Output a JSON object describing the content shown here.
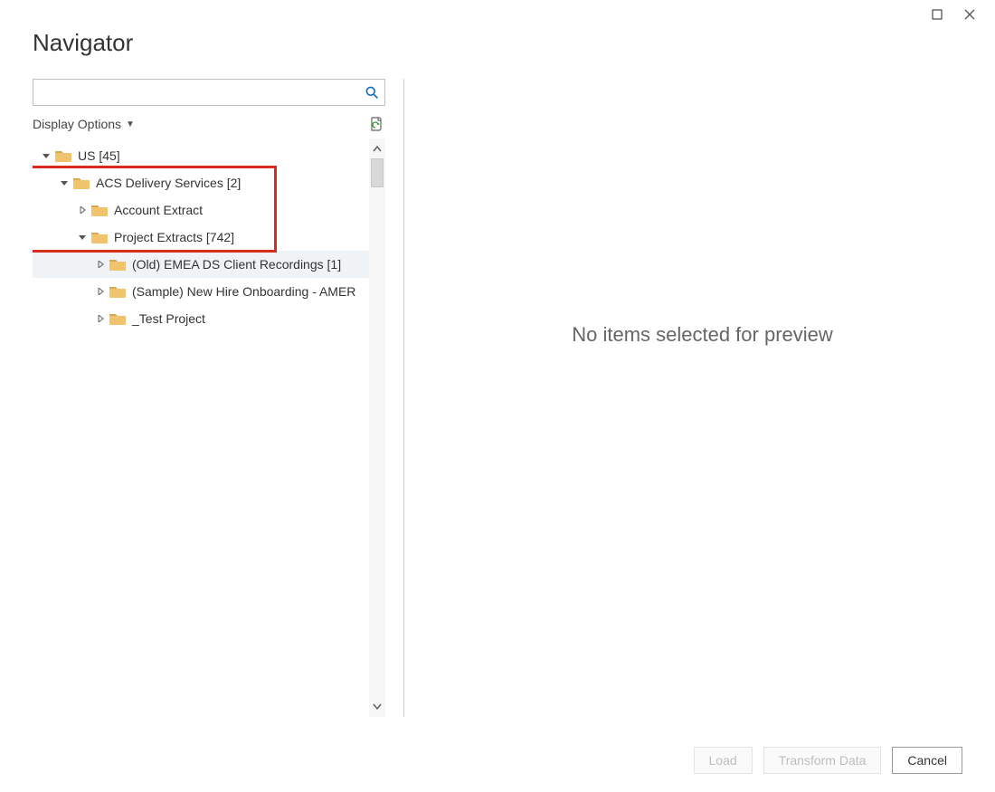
{
  "window": {
    "title": "Navigator"
  },
  "options": {
    "display_label": "Display Options"
  },
  "preview": {
    "empty_text": "No items selected for preview"
  },
  "footer": {
    "load": "Load",
    "transform": "Transform Data",
    "cancel": "Cancel"
  },
  "tree": {
    "items": [
      {
        "label": "US [45]",
        "indent": 0,
        "expanded": true,
        "selected": false
      },
      {
        "label": "ACS Delivery Services [2]",
        "indent": 1,
        "expanded": true,
        "selected": false
      },
      {
        "label": "Account Extract",
        "indent": 2,
        "expanded": false,
        "selected": false
      },
      {
        "label": "Project Extracts [742]",
        "indent": 2,
        "expanded": true,
        "selected": false
      },
      {
        "label": "(Old) EMEA DS Client Recordings [1]",
        "indent": 3,
        "expanded": false,
        "selected": true
      },
      {
        "label": "(Sample) New Hire Onboarding - AMER",
        "indent": 3,
        "expanded": false,
        "selected": false
      },
      {
        "label": "_Test Project",
        "indent": 3,
        "expanded": false,
        "selected": false
      }
    ]
  }
}
